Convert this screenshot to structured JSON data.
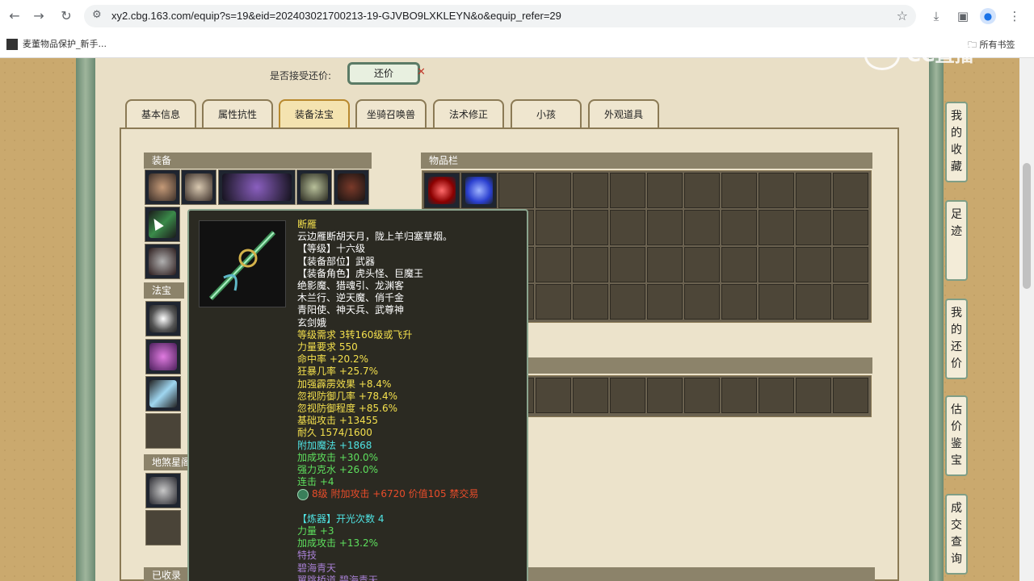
{
  "browser": {
    "url": "xy2.cbg.163.com/equip?s=19&eid=202403021700213-19-GJVBO9LXKLEYN&o&equip_refer=29",
    "bookmark_left": "麦董物品保护_新手...",
    "bookmark_right": "所有书签"
  },
  "watermark": {
    "text": "CC直播"
  },
  "counter_offer": {
    "label": "是否接受还价:",
    "button": "还价"
  },
  "tabs": [
    {
      "label": "基本信息"
    },
    {
      "label": "属性抗性"
    },
    {
      "label": "装备法宝"
    },
    {
      "label": "坐骑召唤兽"
    },
    {
      "label": "法术修正"
    },
    {
      "label": "小孩"
    },
    {
      "label": "外观道具"
    }
  ],
  "panels": {
    "equipment": "装备",
    "magic_treasure": "法宝",
    "earth_star": "地煞星阁",
    "inventory": "物品栏",
    "collected": "已收录"
  },
  "tooltip": {
    "lines": [
      {
        "text": "断雁",
        "color": "yellow"
      },
      {
        "text": "云边雁断胡天月，陇上羊归塞草烟。",
        "color": "white"
      },
      {
        "text": "【等级】十六级",
        "color": "white"
      },
      {
        "text": "【装备部位】武器",
        "color": "white"
      },
      {
        "text": "【装备角色】虎头怪、巨魔王",
        "color": "white"
      },
      {
        "text": "绝影魔、猎魂引、龙渊客",
        "color": "white"
      },
      {
        "text": "木兰行、逆天魔、俏千金",
        "color": "white"
      },
      {
        "text": "青阳使、神天兵、武尊神",
        "color": "white"
      },
      {
        "text": "玄剑娥",
        "color": "white"
      },
      {
        "text": "等级需求 3转160级或飞升",
        "color": "yellow"
      },
      {
        "text": "力量要求 550",
        "color": "yellow"
      },
      {
        "text": "命中率 +20.2%",
        "color": "yellow"
      },
      {
        "text": "狂暴几率 +25.7%",
        "color": "yellow"
      },
      {
        "text": "加强霹雳效果 +8.4%",
        "color": "yellow"
      },
      {
        "text": "忽视防御几率 +78.4%",
        "color": "yellow"
      },
      {
        "text": "忽视防御程度 +85.6%",
        "color": "yellow"
      },
      {
        "text": "基础攻击 +13455",
        "color": "yellow"
      },
      {
        "text": "耐久 1574/1600",
        "color": "yellow"
      },
      {
        "text": "附加魔法 +1868",
        "color": "cyan"
      },
      {
        "text": "加成攻击 +30.0%",
        "color": "green"
      },
      {
        "text": "强力克水 +26.0%",
        "color": "green"
      },
      {
        "text": "连击 +4",
        "color": "green"
      },
      {
        "text": "8级 附加攻击 +6720 价值105 禁交易",
        "color": "red",
        "gem": true
      },
      {
        "text": "",
        "color": "white"
      },
      {
        "text": "【炼器】开光次数 4",
        "color": "cyan"
      },
      {
        "text": "力量 +3",
        "color": "green"
      },
      {
        "text": "加成攻击 +13.2%",
        "color": "green"
      },
      {
        "text": "特技",
        "color": "purple"
      },
      {
        "text": "碧海青天",
        "color": "purple"
      },
      {
        "text": "翼跳桥道 碧海青天",
        "color": "purple"
      }
    ]
  },
  "side_buttons": [
    {
      "label": "我的收藏"
    },
    {
      "label": "足迹"
    },
    {
      "label": "我的还价"
    },
    {
      "label": "估价鉴宝"
    },
    {
      "label": "成交查询"
    }
  ],
  "colors": {
    "yellow": "#f4e04d",
    "white": "#ffffff",
    "green": "#5ee05e",
    "cyan": "#4fe3e3",
    "red": "#e84c2a",
    "purple": "#a67fd1"
  }
}
